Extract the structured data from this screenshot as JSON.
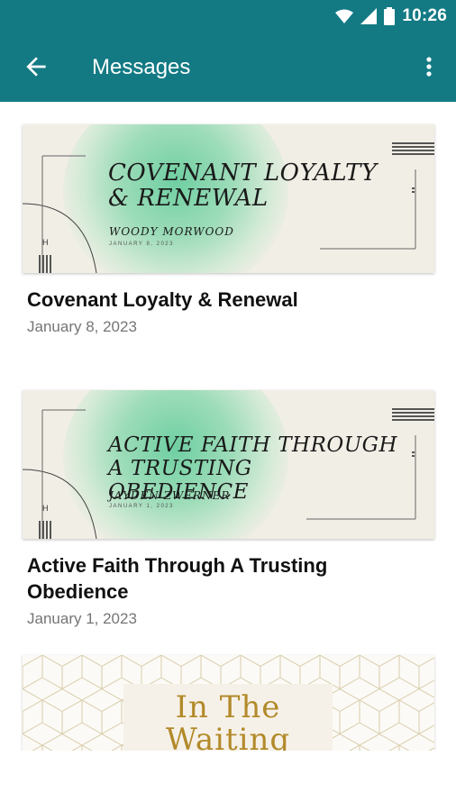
{
  "status_bar": {
    "time": "10:26"
  },
  "app_bar": {
    "title": "Messages",
    "back_icon": "arrow-back-icon",
    "menu_icon": "more-vert-icon"
  },
  "colors": {
    "primary": "#137a84",
    "card_bg": "#f1eee5",
    "accent_gold": "#b28a2a"
  },
  "messages": [
    {
      "banner_title": "Covenant Loyalty & Renewal",
      "banner_speaker": "Woody Morwood",
      "banner_date": "January 8, 2023",
      "title": "Covenant Loyalty & Renewal",
      "date": "January 8, 2023"
    },
    {
      "banner_title": "Active Faith Through A Trusting Obedience",
      "banner_speaker": "Jayden Zwerner",
      "banner_date": "January 1, 2023",
      "title": "Active Faith Through A Trusting Obedience",
      "date": "January 1, 2023"
    },
    {
      "banner_title": "In The Waiting"
    }
  ]
}
